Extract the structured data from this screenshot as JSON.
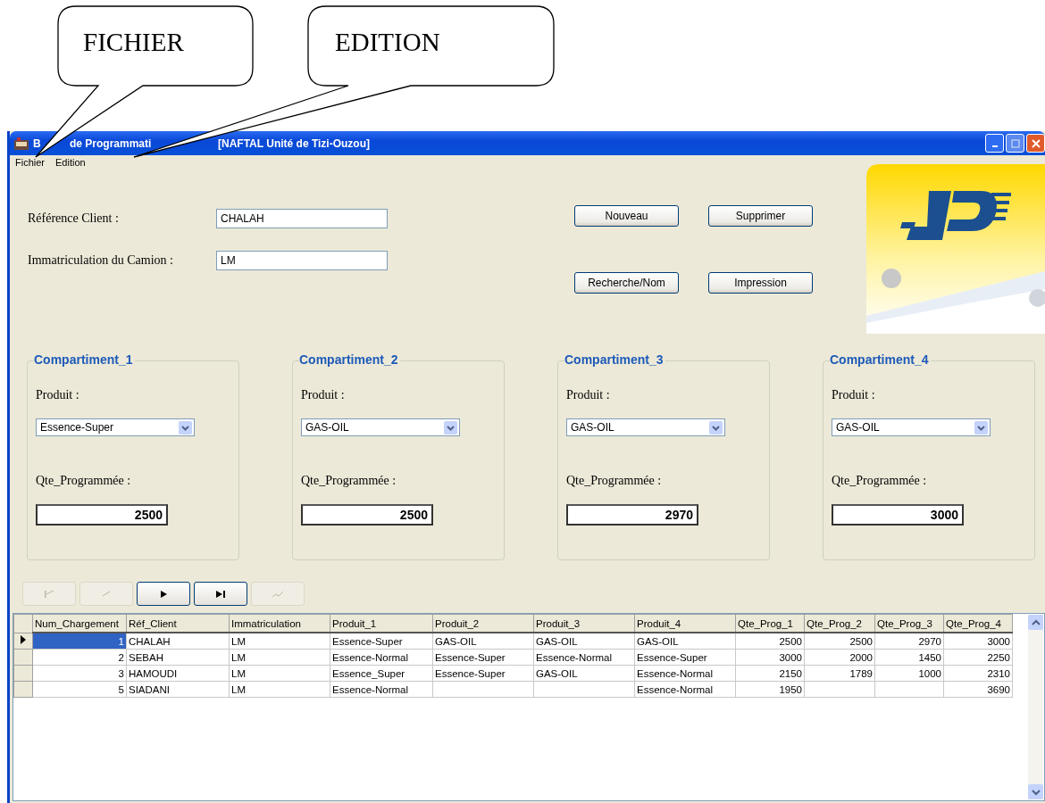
{
  "callouts": [
    {
      "label": "FICHIER"
    },
    {
      "label": "EDITION"
    }
  ],
  "window": {
    "title_parts": [
      "B",
      "de Programmati",
      "[NAFTAL  Unité de Tizi-Ouzou]"
    ]
  },
  "menu": [
    "Fichier",
    "Edition"
  ],
  "fields": [
    {
      "label": "Référence Client :",
      "value": "CHALAH"
    },
    {
      "label": "Immatriculation du Camion :",
      "value": "LM"
    }
  ],
  "buttons": [
    "Nouveau",
    "Supprimer",
    "Recherche/Nom",
    "Impression"
  ],
  "logo": {
    "kind": "picture"
  },
  "compartments": [
    {
      "title": "Compartiment_1",
      "product_label": "Produit :",
      "product": "Essence-Super",
      "qty_label": "Qte_Programmée :",
      "qty": "2500"
    },
    {
      "title": "Compartiment_2",
      "product_label": "Produit :",
      "product": "GAS-OIL",
      "qty_label": "Qte_Programmée :",
      "qty": "2500"
    },
    {
      "title": "Compartiment_3",
      "product_label": "Produit :",
      "product": "GAS-OIL",
      "qty_label": "Qte_Programmée :",
      "qty": "2970"
    },
    {
      "title": "Compartiment_4",
      "product_label": "Produit :",
      "product": "GAS-OIL",
      "qty_label": "Qte_Programmée :",
      "qty": "3000"
    }
  ],
  "nav_buttons": [
    {
      "kind": "first",
      "disabled": true
    },
    {
      "kind": "prev",
      "disabled": true
    },
    {
      "kind": "next",
      "disabled": false
    },
    {
      "kind": "last",
      "disabled": false
    },
    {
      "kind": "edit",
      "disabled": true
    }
  ],
  "table": {
    "columns": [
      "Num_Chargement",
      "Réf_Client",
      "Immatriculation",
      "Produit_1",
      "Produit_2",
      "Produit_3",
      "Produit_4",
      "Qte_Prog_1",
      "Qte_Prog_2",
      "Qte_Prog_3",
      "Qte_Prog_4"
    ],
    "rows": [
      {
        "selected": true,
        "cells": [
          "1",
          "CHALAH",
          "LM",
          "Essence-Super",
          "GAS-OIL",
          "GAS-OIL",
          "GAS-OIL",
          "2500",
          "2500",
          "2970",
          "3000"
        ]
      },
      {
        "selected": false,
        "cells": [
          "2",
          "SEBAH",
          "LM",
          "Essence-Normal",
          "Essence-Super",
          "Essence-Normal",
          "Essence-Super",
          "3000",
          "2000",
          "1450",
          "2250"
        ]
      },
      {
        "selected": false,
        "cells": [
          "3",
          "HAMOUDI",
          "LM",
          "Essence_Super",
          "Essence-Super",
          "GAS-OIL",
          "Essence-Normal",
          "2150",
          "1789",
          "1000",
          "2310"
        ]
      },
      {
        "selected": false,
        "cells": [
          "5",
          "SIADANI",
          "LM",
          "Essence-Normal",
          null,
          null,
          "Essence-Normal",
          "1950",
          null,
          null,
          "3690"
        ]
      }
    ]
  }
}
